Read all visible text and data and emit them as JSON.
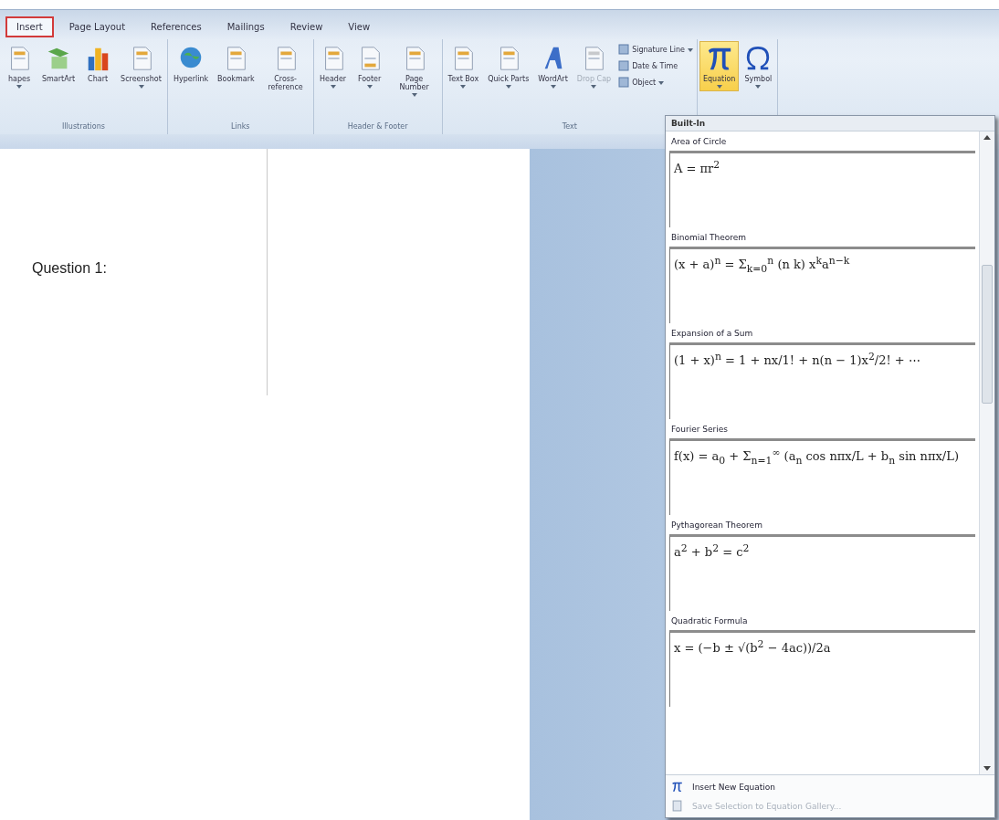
{
  "tabs": [
    {
      "label": "Insert",
      "selected": true
    },
    {
      "label": "Page Layout",
      "selected": false
    },
    {
      "label": "References",
      "selected": false
    },
    {
      "label": "Mailings",
      "selected": false
    },
    {
      "label": "Review",
      "selected": false
    },
    {
      "label": "View",
      "selected": false
    }
  ],
  "ribbon_groups": [
    {
      "label": "Illustrations",
      "buttons": [
        {
          "label": "hapes",
          "dropdown": true,
          "selected": false,
          "disabled": false
        },
        {
          "label": "SmartArt",
          "dropdown": false,
          "selected": false,
          "disabled": false
        },
        {
          "label": "Chart",
          "dropdown": false,
          "selected": false,
          "disabled": false
        },
        {
          "label": "Screenshot",
          "dropdown": true,
          "selected": false,
          "disabled": false
        }
      ]
    },
    {
      "label": "Links",
      "buttons": [
        {
          "label": "Hyperlink",
          "dropdown": false,
          "selected": false,
          "disabled": false
        },
        {
          "label": "Bookmark",
          "dropdown": false,
          "selected": false,
          "disabled": false
        },
        {
          "label": "Cross-reference",
          "dropdown": false,
          "selected": false,
          "disabled": false
        }
      ]
    },
    {
      "label": "Header & Footer",
      "buttons": [
        {
          "label": "Header",
          "dropdown": true,
          "selected": false,
          "disabled": false
        },
        {
          "label": "Footer",
          "dropdown": true,
          "selected": false,
          "disabled": false
        },
        {
          "label": "Page Number",
          "dropdown": true,
          "selected": false,
          "disabled": false
        }
      ]
    },
    {
      "label": "Text",
      "buttons": [
        {
          "label": "Text Box",
          "dropdown": true,
          "selected": false,
          "disabled": false
        },
        {
          "label": "Quick Parts",
          "dropdown": true,
          "selected": false,
          "disabled": false
        },
        {
          "label": "WordArt",
          "dropdown": true,
          "selected": false,
          "disabled": false
        },
        {
          "label": "Drop Cap",
          "dropdown": true,
          "selected": false,
          "disabled": true
        }
      ],
      "small_buttons": [
        {
          "label": "Signature Line",
          "dropdown": true
        },
        {
          "label": "Date & Time",
          "dropdown": false
        },
        {
          "label": "Object",
          "dropdown": true
        }
      ]
    },
    {
      "buttons": [
        {
          "label": "Equation",
          "dropdown": true,
          "selected": true,
          "disabled": false
        },
        {
          "label": "Symbol",
          "dropdown": true,
          "selected": false,
          "disabled": false
        }
      ]
    }
  ],
  "document": {
    "text": "Question 1:"
  },
  "equation_gallery": {
    "heading": "Built-In",
    "items": [
      {
        "name": "Area of Circle",
        "equation": "A = πr$^{2}$"
      },
      {
        "name": "Binomial Theorem",
        "equation": "(x + a)$^{n}$ = Σ$_{k=0}$$^{n}$ (n k) x$^{k}$a$^{n−k}$"
      },
      {
        "name": "Expansion of a Sum",
        "equation": "(1 + x)$^{n}$ = 1 + nx/1! + n(n − 1)x$^{2}$/2! + ⋯"
      },
      {
        "name": "Fourier Series",
        "equation": "f(x) = a$_{0}$ + Σ$_{n=1}$$^{∞}$ (a$_{n}$ cos nπx/L + b$_{n}$ sin nπx/L)"
      },
      {
        "name": "Pythagorean Theorem",
        "equation": "a$^{2}$ + b$^{2}$ = c$^{2}$"
      },
      {
        "name": "Quadratic Formula",
        "equation": "x = (−b ± √(b$^{2}$ − 4ac))/2a"
      }
    ],
    "commands": [
      {
        "label": "Insert New Equation",
        "disabled": false
      },
      {
        "label": "Save Selection to Equation Gallery...",
        "disabled": true
      }
    ]
  }
}
